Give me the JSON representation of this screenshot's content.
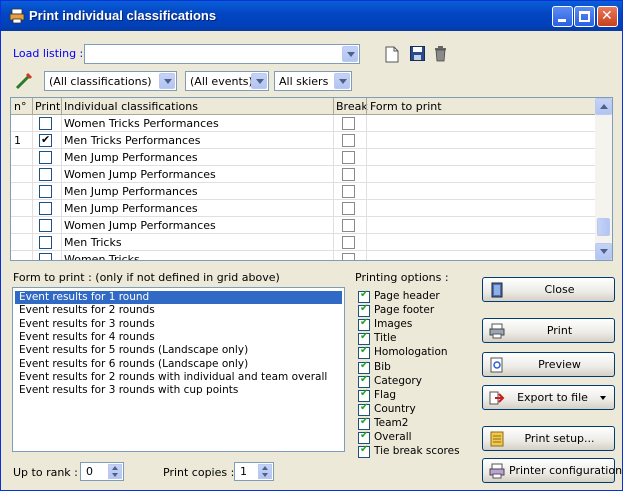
{
  "window": {
    "title": "Print individual classifications"
  },
  "load": {
    "label": "Load listing :",
    "value": ""
  },
  "filters": [
    {
      "value": "(All classifications)"
    },
    {
      "value": "(All events)"
    },
    {
      "value": "All skiers"
    }
  ],
  "grid": {
    "headers": {
      "num": "n°",
      "print": "Print",
      "name": "Individual classifications",
      "break": "Break",
      "form": "Form to print"
    },
    "rows": [
      {
        "num": "",
        "checked": false,
        "name": "Women Tricks Performances"
      },
      {
        "num": "1",
        "checked": true,
        "name": "Men Tricks Performances"
      },
      {
        "num": "",
        "checked": false,
        "name": "Men Jump Performances"
      },
      {
        "num": "",
        "checked": false,
        "name": "Women Jump Performances"
      },
      {
        "num": "",
        "checked": false,
        "name": "Men Jump Performances"
      },
      {
        "num": "",
        "checked": false,
        "name": "Men Jump Performances"
      },
      {
        "num": "",
        "checked": false,
        "name": "Women Jump Performances"
      },
      {
        "num": "",
        "checked": false,
        "name": "Men Tricks"
      },
      {
        "num": "",
        "checked": false,
        "name": "Women Tricks"
      }
    ]
  },
  "form_to_print": {
    "label": "Form to print :  (only if not defined in grid above)",
    "items": [
      "Event results for 1 round",
      "Event results for 2 rounds",
      "Event results for 3 rounds",
      "Event results for 4 rounds",
      "Event results for 5 rounds (Landscape only)",
      "Event results for 6 rounds (Landscape only)",
      "Event results for 2 rounds with individual and team overall",
      "Event results for 3 rounds with cup points"
    ],
    "selected_index": 0
  },
  "printing_options": {
    "label": "Printing options :",
    "items": [
      "Page header",
      "Page footer",
      "Images",
      "Title",
      "Homologation",
      "Bib",
      "Category",
      "Flag",
      "Country",
      "Team2",
      "Overall",
      "Tie break scores"
    ]
  },
  "buttons": {
    "close": "Close",
    "print": "Print",
    "preview": "Preview",
    "export": "Export to file",
    "print_setup": "Print setup...",
    "printer_config": "Printer configuration..."
  },
  "bottom": {
    "up_to_rank_label": "Up to rank :",
    "up_to_rank_value": "0",
    "print_copies_label": "Print copies :",
    "print_copies_value": "1"
  },
  "colors": {
    "title_bar": "#0346c4",
    "selection": "#316ac5",
    "dialog_bg": "#ece9d8"
  }
}
